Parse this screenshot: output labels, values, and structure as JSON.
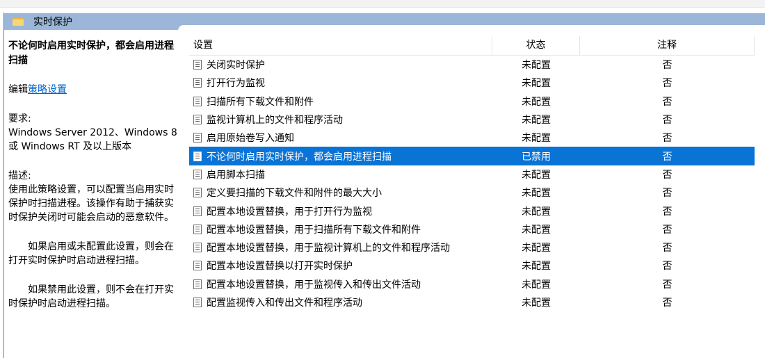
{
  "header": {
    "title": "实时保护"
  },
  "left_pane": {
    "policy_title": "不论何时启用实时保护，都会启用进程扫描",
    "edit_prefix": "编辑",
    "edit_link": "策略设置",
    "requirements_label": "要求:",
    "requirements_text": "Windows Server 2012、Windows 8 或 Windows RT 及以上版本",
    "description_label": "描述:",
    "description_text": "使用此策略设置，可以配置当启用实时保护时扫描进程。该操作有助于捕获实时保护关闭时可能会启动的恶意软件。",
    "paragraph_enabled": "如果启用或未配置此设置，则会在打开实时保护时启动进程扫描。",
    "paragraph_disabled": "如果禁用此设置，则不会在打开实时保护时启动进程扫描。"
  },
  "table": {
    "columns": [
      "设置",
      "状态",
      "注释"
    ],
    "rows": [
      {
        "setting": "关闭实时保护",
        "state": "未配置",
        "note": "否"
      },
      {
        "setting": "打开行为监视",
        "state": "未配置",
        "note": "否"
      },
      {
        "setting": "扫描所有下载文件和附件",
        "state": "未配置",
        "note": "否"
      },
      {
        "setting": "监视计算机上的文件和程序活动",
        "state": "未配置",
        "note": "否"
      },
      {
        "setting": "启用原始卷写入通知",
        "state": "未配置",
        "note": "否"
      },
      {
        "setting": "不论何时启用实时保护，都会启用进程扫描",
        "state": "已禁用",
        "note": "否",
        "selected": true
      },
      {
        "setting": "启用脚本扫描",
        "state": "未配置",
        "note": "否"
      },
      {
        "setting": "定义要扫描的下载文件和附件的最大大小",
        "state": "未配置",
        "note": "否"
      },
      {
        "setting": "配置本地设置替换，用于打开行为监视",
        "state": "未配置",
        "note": "否"
      },
      {
        "setting": "配置本地设置替换，用于扫描所有下载文件和附件",
        "state": "未配置",
        "note": "否"
      },
      {
        "setting": "配置本地设置替换，用于监视计算机上的文件和程序活动",
        "state": "未配置",
        "note": "否"
      },
      {
        "setting": "配置本地设置替换以打开实时保护",
        "state": "未配置",
        "note": "否"
      },
      {
        "setting": "配置本地设置替换，用于监视传入和传出文件活动",
        "state": "未配置",
        "note": "否"
      },
      {
        "setting": "配置监视传入和传出文件和程序活动",
        "state": "未配置",
        "note": "否"
      }
    ]
  },
  "colors": {
    "header_band": "#9bb6d8",
    "selection": "#0a74d6",
    "link": "#0066cc"
  },
  "icons": {
    "header": "folder-icon",
    "row": "policy-setting-icon"
  }
}
